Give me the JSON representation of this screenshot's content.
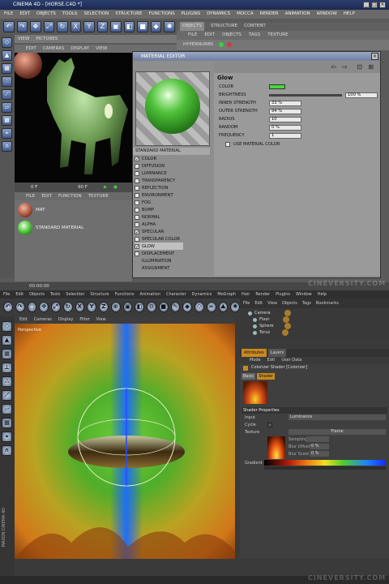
{
  "top_app": {
    "title": "CINEMA 4D - [HORSE.C4D *]",
    "window_buttons": [
      "_",
      "□",
      "×"
    ],
    "menu": [
      "FILE",
      "EDIT",
      "OBJECTS",
      "TOOLS",
      "SELECTION",
      "STRUCTURE",
      "FUNCTIONS",
      "PLUGINS",
      "DYNAMICS",
      "MOCCA",
      "RENDER",
      "ANIMATION",
      "WINDOW",
      "HELP"
    ],
    "view_tabs": [
      "VIEW",
      "PICTURES"
    ],
    "view_menu": [
      "EDIT",
      "CAMERAS",
      "DISPLAY",
      "VIEW"
    ],
    "timeline": {
      "frame_start": "0 F",
      "frame_end": "90 F"
    },
    "mat_menu": [
      "FILE",
      "EDIT",
      "FUNCTION",
      "TEXTURE"
    ],
    "materials": [
      {
        "name": "MAT",
        "color": "#b35a44"
      },
      {
        "name": "STANDARD MATERIAL",
        "color": "#62c84a"
      }
    ],
    "status_time": "00:00:00",
    "obj_tabs": [
      "OBJECTS",
      "STRUCTURE",
      "CONTENT"
    ],
    "obj_menu": [
      "FILE",
      "EDIT",
      "OBJECTS",
      "TAGS",
      "TEXTURE"
    ],
    "obj_item": "HYPERNURBS",
    "watermark": "CINEVERSITY.COM"
  },
  "material_editor": {
    "title": "MATERIAL EDITOR",
    "channel_header": "STANDARD MATERIAL",
    "channels": [
      {
        "name": "COLOR",
        "checked": true
      },
      {
        "name": "DIFFUSION",
        "checked": false
      },
      {
        "name": "LUMINANCE",
        "checked": false
      },
      {
        "name": "TRANSPARENCY",
        "checked": false
      },
      {
        "name": "REFLECTION",
        "checked": false
      },
      {
        "name": "ENVIRONMENT",
        "checked": false
      },
      {
        "name": "FOG",
        "checked": false
      },
      {
        "name": "BUMP",
        "checked": false
      },
      {
        "name": "NORMAL",
        "checked": false
      },
      {
        "name": "ALPHA",
        "checked": false
      },
      {
        "name": "SPECULAR",
        "checked": true
      },
      {
        "name": "SPECULAR COLOR",
        "checked": false
      },
      {
        "name": "GLOW",
        "checked": true
      },
      {
        "name": "DISPLACEMENT",
        "checked": false
      },
      {
        "name": "ILLUMINATION",
        "checked": null
      },
      {
        "name": "ASSIGNMENT",
        "checked": null
      }
    ],
    "props_title": "Glow",
    "props": {
      "color_label": "COLOR",
      "color_value": "#43d83a",
      "brightness_label": "BRIGHTNESS",
      "brightness_value": "100 %",
      "inner_label": "INNER STRENGTH",
      "inner_value": "33 %",
      "outer_label": "OUTER STRENGTH",
      "outer_value": "94 %",
      "radius_label": "RADIUS",
      "radius_value": "10",
      "random_label": "RANDOM",
      "random_value": "0 %",
      "frequency_label": "FREQUENCY",
      "frequency_value": "1",
      "use_material_color": "USE MATERIAL COLOR"
    }
  },
  "bottom_app": {
    "menu": [
      "File",
      "Edit",
      "Objects",
      "Tools",
      "Selection",
      "Structure",
      "Functions",
      "Animation",
      "Character",
      "Dynamics",
      "MoGraph",
      "Hair",
      "Render",
      "Plugins",
      "Window",
      "Help"
    ],
    "view_menu": [
      "Edit",
      "Cameras",
      "Display",
      "Filter",
      "View"
    ],
    "viewport_label": "Perspective",
    "obj_menu": [
      "File",
      "Edit",
      "View",
      "Objects",
      "Tags",
      "Bookmarks"
    ],
    "objects": [
      "Camera",
      "Floor",
      "Sphere",
      "Torus"
    ],
    "attr_tabs": [
      "Attributes",
      "Layers"
    ],
    "attr_menu": [
      "Mode",
      "Edit",
      "User Data"
    ],
    "shader_title": "Colorizer Shader [Colorizer]",
    "shader_tabs": [
      "Basic",
      "Shader"
    ],
    "shader_props_title": "Shader Properties",
    "input_label": "Input",
    "input_value": "Luminance",
    "cycle_label": "Cycle",
    "texture_label": "Texture",
    "texture_value": "Flame",
    "sampling_label": "Sampling",
    "blur_offset_label": "Blur Offset",
    "blur_offset_value": "0 %",
    "blur_scale_label": "Blur Scale",
    "blur_scale_value": "0 %",
    "gradient_label": "Gradient",
    "side_label": "MAXON CINEMA 4D",
    "watermark": "CINEVERSITY.COM"
  }
}
